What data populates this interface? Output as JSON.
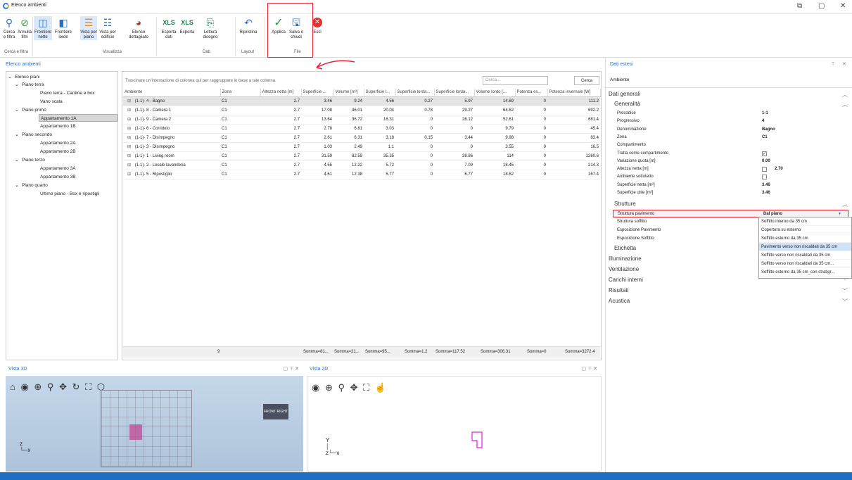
{
  "window": {
    "title": "Elenco ambienti"
  },
  "ribbon": {
    "buttons": [
      {
        "label": "Cerca e filtra",
        "icon": "search-filter-icon"
      },
      {
        "label": "Annulla filtri",
        "icon": "clear-filter-icon"
      },
      {
        "label": "Frontiere nette",
        "icon": "net-boundary-icon"
      },
      {
        "label": "Frontiere lorde",
        "icon": "gross-boundary-icon"
      },
      {
        "label": "Vista per piano",
        "icon": "floor-view-icon"
      },
      {
        "label": "Vista per edificio",
        "icon": "building-view-icon"
      },
      {
        "label": "Elenco dettagliato",
        "icon": "pie-chart-icon"
      },
      {
        "label": "Esporta dati",
        "icon": "xlsx-icon"
      },
      {
        "label": "Esporta",
        "icon": "xlsx-icon"
      },
      {
        "label": "Lettura disegno",
        "icon": "drawing-icon"
      },
      {
        "label": "Ripristina",
        "icon": "undo-icon"
      },
      {
        "label": "Applica",
        "icon": "check-icon"
      },
      {
        "label": "Salva e chiudi",
        "icon": "save-close-icon"
      },
      {
        "label": "Esci",
        "icon": "exit-icon"
      }
    ],
    "groups": [
      "Cerca e filtra",
      "Visualizza",
      "Dati",
      "Layout",
      "File"
    ]
  },
  "left_panel": {
    "title": "Elenco ambienti",
    "tree": [
      {
        "label": "Elenco piani",
        "level": 0,
        "expanded": true
      },
      {
        "label": "Piano terra",
        "level": 1,
        "expanded": true
      },
      {
        "label": "Piano terra - Cantine e box",
        "level": 2
      },
      {
        "label": "Vano scala",
        "level": 2
      },
      {
        "label": "Piano primo",
        "level": 1,
        "expanded": true
      },
      {
        "label": "Appartamento 1A",
        "level": 2,
        "selected": true
      },
      {
        "label": "Appartamento 1B",
        "level": 2
      },
      {
        "label": "Piano secondo",
        "level": 1,
        "expanded": true
      },
      {
        "label": "Appartamento 2A",
        "level": 2
      },
      {
        "label": "Appartamento 2B",
        "level": 2
      },
      {
        "label": "Piano terzo",
        "level": 1,
        "expanded": true
      },
      {
        "label": "Appartamento 3A",
        "level": 2
      },
      {
        "label": "Appartamento 3B",
        "level": 2
      },
      {
        "label": "Piano quarto",
        "level": 1,
        "expanded": true
      },
      {
        "label": "Ultimo piano - Box e ripostigli",
        "level": 2
      }
    ]
  },
  "grid": {
    "group_hint": "Trascinare un'intestazione di colonna qui per raggruppare in base a tale colonna.",
    "search_placeholder": "Cerca...",
    "search_button": "Cerca",
    "columns": [
      "Ambiente",
      "Zona",
      "Altezza netta [m]",
      "Superficie ...",
      "Volume [m³]",
      "Superficie l...",
      "Superficie lorda...",
      "Superficie lorda...",
      "Volume lordo [...",
      "Potenza es...",
      "Potenza invernale [W]"
    ],
    "rows": [
      [
        "(1-1)-  4 - Bagno",
        "C1",
        "2.7",
        "3.46",
        "9.24",
        "4.56",
        "0.27",
        "5.97",
        "14.69",
        "0",
        "111.2"
      ],
      [
        "(1-1)-  8 - Camera 1",
        "C1",
        "2.7",
        "17.08",
        "46.01",
        "20.04",
        "0.78",
        "29.27",
        "64.62",
        "0",
        "692.2"
      ],
      [
        "(1-1)-  9 - Camera 2",
        "C1",
        "2.7",
        "13.64",
        "36.72",
        "16.31",
        "0",
        "26.12",
        "52.61",
        "0",
        "681.4"
      ],
      [
        "(1-1)-  6 - Corridoio",
        "C1",
        "2.7",
        "2.78",
        "6.81",
        "3.03",
        "0",
        "0",
        "9.79",
        "0",
        "45.4"
      ],
      [
        "(1-1)-  7 - Disimpegno",
        "C1",
        "2.7",
        "2.61",
        "6.31",
        "3.18",
        "0.15",
        "3.44",
        "9.98",
        "0",
        "83.4"
      ],
      [
        "(1-1)-  3 - Disimpegno",
        "C1",
        "2.7",
        "1.03",
        "2.49",
        "1.1",
        "0",
        "0",
        "3.55",
        "0",
        "16.5"
      ],
      [
        "(1-1)-  1 - Living room",
        "C1",
        "2.7",
        "31.59",
        "82.59",
        "35.35",
        "0",
        "38.86",
        "114",
        "0",
        "1260.6"
      ],
      [
        "(1-1)-  2 - Locale lavanderia",
        "C1",
        "2.7",
        "4.55",
        "12.22",
        "5.72",
        "0",
        "7.09",
        "18.45",
        "0",
        "214.3"
      ],
      [
        "(1-1)-  5 - Ripostiglio",
        "C1",
        "2.7",
        "4.61",
        "12.38",
        "5.77",
        "0",
        "6.77",
        "18.62",
        "0",
        "167.4"
      ]
    ],
    "summary": {
      "count": "9",
      "s1": "Somma=81...",
      "s2": "Somma=21...",
      "s3": "Somma=95...",
      "s4": "Somma=1.2",
      "s5": "Somma=117.52",
      "s6": "Somma=306.31",
      "s7": "Somma=0",
      "s8": "Somma=3272.4"
    }
  },
  "right_panel": {
    "title": "Dati estesi",
    "tab": "Ambiente",
    "sections": {
      "dati_generali": "Dati generali",
      "generalita": "Generalità",
      "strutture": "Strutture",
      "etichetta": "Etichetta",
      "illuminazione": "Illuminazione",
      "ventilazione": "Ventilazione",
      "carichi": "Carichi interni",
      "risultati": "Risultati",
      "acustica": "Acustica"
    },
    "props": [
      {
        "k": "Precodice",
        "v": "1-1"
      },
      {
        "k": "Progressivo",
        "v": "4"
      },
      {
        "k": "Denominazione",
        "v": "Bagno"
      },
      {
        "k": "Zona",
        "v": "C1"
      },
      {
        "k": "Compartimento",
        "v": ""
      },
      {
        "k": "Tratta come compartimento",
        "v": ""
      },
      {
        "k": "Variazione quota [m]",
        "v": "0.00"
      },
      {
        "k": "Altezza netta [m]",
        "v": "2.70"
      },
      {
        "k": "Ambiente sottotetto",
        "v": ""
      },
      {
        "k": "Superficie netta [m²]",
        "v": "3.46"
      },
      {
        "k": "Superficie utile [m²]",
        "v": "3.46"
      }
    ],
    "struct_props": [
      {
        "k": "Struttura pavimento",
        "v": "Dal piano"
      },
      {
        "k": "Struttura soffitto",
        "v": ""
      },
      {
        "k": "Esposizione Pavimento",
        "v": ""
      },
      {
        "k": "Esposizione Soffitto",
        "v": ""
      }
    ],
    "dropdown": [
      "Soffitto interno da 35 cm",
      "Copertura su esterno",
      "Soffitto esterno da 35 cm",
      "Pavimento verso non riscaldati da 35 cm",
      "Soffitto verso non riscaldati da 35 cm",
      "Soffitto verso non riscaldati da 35 cm...",
      "Soffitto esterno da 35 cm_con stratigr..."
    ]
  },
  "view3d": {
    "title": "Vista 3D"
  },
  "view2d": {
    "title": "Vista 2D"
  },
  "colors": {
    "accent": "#2a6fc9",
    "status": "#1f6fc6",
    "highlight": "#e23"
  }
}
